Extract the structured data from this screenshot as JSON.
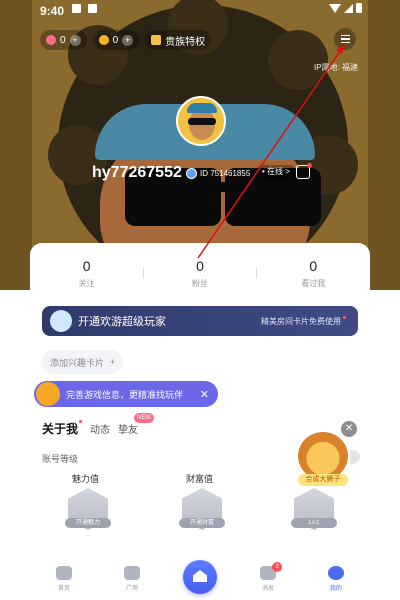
{
  "status_bar": {
    "time": "9:40"
  },
  "topbar": {
    "gems": "0",
    "coins": "0",
    "vip_label": "贵族特权",
    "ip_location": "IP属地: 福建"
  },
  "profile": {
    "username": "hy77267552",
    "id_label": "ID 751461855",
    "online_label": "• 在线 >"
  },
  "stats": [
    {
      "value": "0",
      "label": "关注"
    },
    {
      "value": "0",
      "label": "粉丝"
    },
    {
      "value": "0",
      "label": "看过我"
    }
  ],
  "banner": {
    "title": "开通欢游超级玩家",
    "subtitle": "精美房间卡片免费使用"
  },
  "interest_card": {
    "label": "添加兴趣卡片",
    "plus": "+"
  },
  "toast": {
    "text": "完善游戏信息，更精准找玩伴",
    "close": "✕"
  },
  "tabs": {
    "about": "关于我",
    "moments": "动态",
    "friends": "挚友",
    "friends_badge": "NEW"
  },
  "account_level": {
    "label": "账号等级",
    "charm_label": "魅力值",
    "wealth_label": "财富值",
    "charm_cap": "开通魅力",
    "wealth_cap": "开通财富",
    "level_cap": "Lv.1"
  },
  "promo": {
    "label": "合成大狮子"
  },
  "bottom_nav": [
    {
      "label": "首页"
    },
    {
      "label": "广场"
    },
    {
      "label": "消息",
      "badge": "3"
    },
    {
      "label": "我的"
    }
  ],
  "colors": {
    "accent": "#4e6cf5",
    "banner_bg": "#2f3a6b",
    "toast_bg": "#6a67e8",
    "hero_bg": "#8b6a2d",
    "annotation_arrow": "#e01010"
  }
}
